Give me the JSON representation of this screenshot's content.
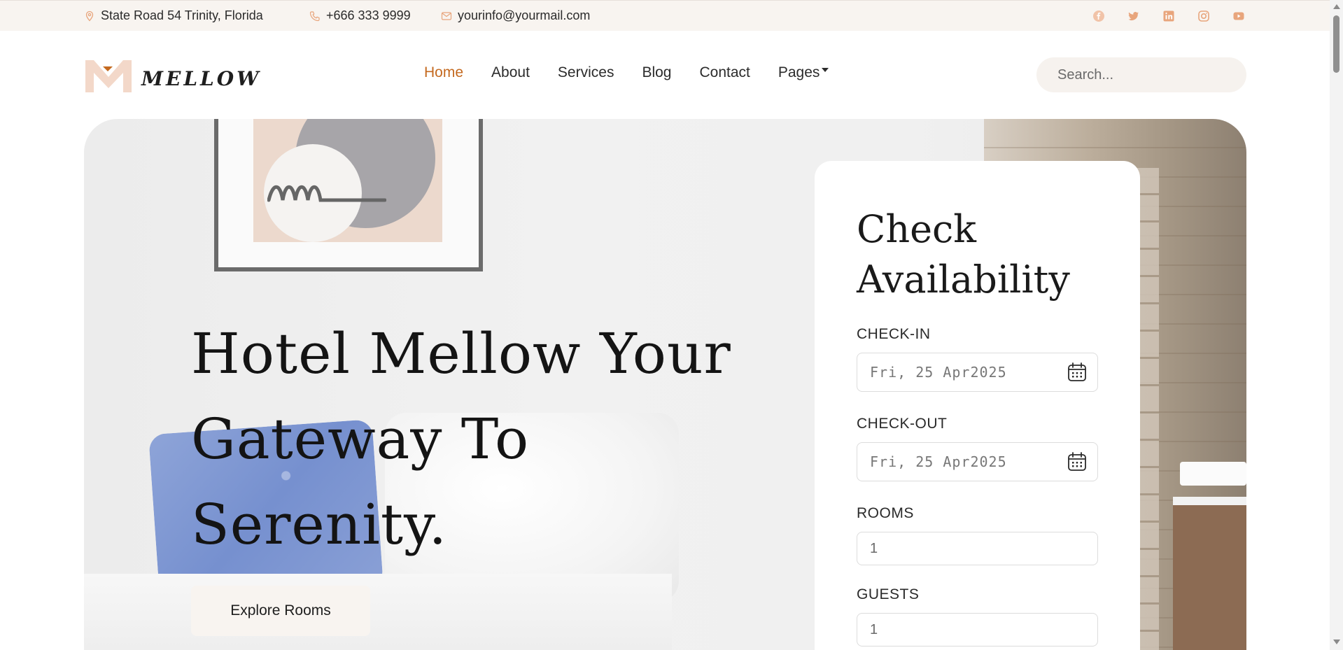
{
  "topbar": {
    "address": "State Road 54 Trinity, Florida",
    "phone": "+666 333 9999",
    "email": "yourinfo@yourmail.com",
    "icon_color": "#e8a57c",
    "socials": [
      "facebook-icon",
      "twitter-icon",
      "linkedin-icon",
      "instagram-icon",
      "youtube-icon"
    ]
  },
  "brand": {
    "name": "MELLOW",
    "accent": "#c4691f",
    "logo_color": "#f3d8c9"
  },
  "nav": {
    "items": [
      {
        "label": "Home",
        "active": true
      },
      {
        "label": "About"
      },
      {
        "label": "Services"
      },
      {
        "label": "Blog"
      },
      {
        "label": "Contact"
      },
      {
        "label": "Pages",
        "dropdown": true
      }
    ]
  },
  "search": {
    "placeholder": "Search..."
  },
  "hero": {
    "title": "Hotel Mellow Your Gateway To Serenity.",
    "cta_label": "Explore Rooms"
  },
  "booking": {
    "title": "Check Availability",
    "checkin_label": "CHECK-IN",
    "checkin_value": "Fri, 25 Apr2025",
    "checkout_label": "CHECK-OUT",
    "checkout_value": "Fri, 25 Apr2025",
    "rooms_label": "ROOMS",
    "rooms_value": "1",
    "guests_label": "GUESTS",
    "guests_value": "1"
  }
}
